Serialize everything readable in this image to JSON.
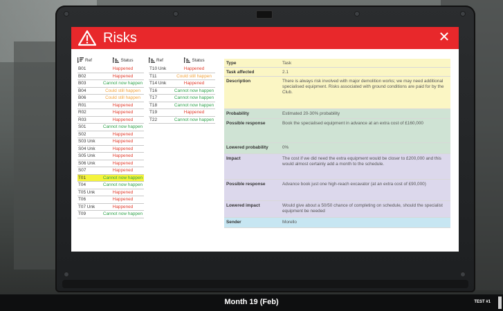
{
  "window": {
    "title": "Risks",
    "close_symbol": "✕",
    "accent_color": "#e8282b"
  },
  "list_headers": {
    "ref": "Ref",
    "status": "Status"
  },
  "risk_list_col1": [
    {
      "ref": "B01",
      "status": "Happened",
      "type": "happened"
    },
    {
      "ref": "B02",
      "status": "Happened",
      "type": "happened"
    },
    {
      "ref": "B03",
      "status": "Cannot now happen",
      "type": "cannot"
    },
    {
      "ref": "B04",
      "status": "Could still happen",
      "type": "could"
    },
    {
      "ref": "B06",
      "status": "Could still happen",
      "type": "could"
    },
    {
      "ref": "R01",
      "status": "Happened",
      "type": "happened"
    },
    {
      "ref": "R02",
      "status": "Happened",
      "type": "happened"
    },
    {
      "ref": "R03",
      "status": "Happened",
      "type": "happened"
    },
    {
      "ref": "S01",
      "status": "Cannot now happen",
      "type": "cannot"
    },
    {
      "ref": "S02",
      "status": "Happened",
      "type": "happened"
    },
    {
      "ref": "S03 Unk",
      "status": "Happened",
      "type": "happened"
    },
    {
      "ref": "S04 Unk",
      "status": "Happened",
      "type": "happened"
    },
    {
      "ref": "S05 Unk",
      "status": "Happened",
      "type": "happened"
    },
    {
      "ref": "S06 Unk",
      "status": "Happened",
      "type": "happened"
    },
    {
      "ref": "S07",
      "status": "Happened",
      "type": "happened"
    },
    {
      "ref": "T01",
      "status": "Cannot now happen",
      "type": "cannot",
      "selected": true
    },
    {
      "ref": "T04",
      "status": "Cannot now happen",
      "type": "cannot"
    },
    {
      "ref": "T05 Unk",
      "status": "Happened",
      "type": "happened"
    },
    {
      "ref": "T06",
      "status": "Happened",
      "type": "happened"
    },
    {
      "ref": "T07 Unk",
      "status": "Happened",
      "type": "happened"
    },
    {
      "ref": "T09",
      "status": "Cannot now happen",
      "type": "cannot"
    }
  ],
  "risk_list_col2": [
    {
      "ref": "T10 Unk",
      "status": "Happened",
      "type": "happened"
    },
    {
      "ref": "T11",
      "status": "Could still happen",
      "type": "could"
    },
    {
      "ref": "T14 Unk",
      "status": "Happened",
      "type": "happened"
    },
    {
      "ref": "T16",
      "status": "Cannot now happen",
      "type": "cannot"
    },
    {
      "ref": "T17",
      "status": "Cannot now happen",
      "type": "cannot"
    },
    {
      "ref": "T18",
      "status": "Cannot now happen",
      "type": "cannot"
    },
    {
      "ref": "T19",
      "status": "Happened",
      "type": "happened"
    },
    {
      "ref": "T22",
      "status": "Cannot now happen",
      "type": "cannot"
    }
  ],
  "status_colors": {
    "happened": "#e23b2b",
    "could": "#f2a23a",
    "cannot": "#2ea24a",
    "selected_row": "#f4f33c"
  },
  "detail": {
    "type": {
      "label": "Type",
      "value": "Task",
      "color": "#fbf6c4"
    },
    "task_affected": {
      "label": "Task affected",
      "value": "2.1",
      "color": "#fbf6c4"
    },
    "description": {
      "label": "Description",
      "value": "There is always risk involved with major demolition works; we may need additional specialised equipment. Risks associated with ground conditions are paid for by the Club.",
      "color": "#fbf6c4"
    },
    "probability": {
      "label": "Probability",
      "value": "Estimated 20-30% probability",
      "color": "#cfe3d4"
    },
    "possible_response_1": {
      "label": "Possible response",
      "value": "Book the specialised equipment in advance at an extra cost of £160,000",
      "color": "#cfe3d4"
    },
    "lowered_probability": {
      "label": "Lowered probability",
      "value": "0%",
      "color": "#cfe3d4"
    },
    "impact": {
      "label": "Impact",
      "value": "The cost if we did need the extra equipment would be closer to £200,000 and this would almost certainly add a month to the schedule.",
      "color": "#dcd8ec"
    },
    "possible_response_2": {
      "label": "Possible response",
      "value": "Advance book just one high-reach excavator (at an extra cost of £90,000)",
      "color": "#dcd8ec"
    },
    "lowered_impact": {
      "label": "Lowered impact",
      "value": "Would give about a 50/50 chance of completing on schedule, should the specialist equipment be needed",
      "color": "#dcd8ec"
    },
    "sender": {
      "label": "Sender",
      "value": "Morello",
      "color": "#c7e6f2"
    }
  },
  "taskbar": {
    "month": "Month 19 (Feb)",
    "test_id": "TEST #1"
  }
}
